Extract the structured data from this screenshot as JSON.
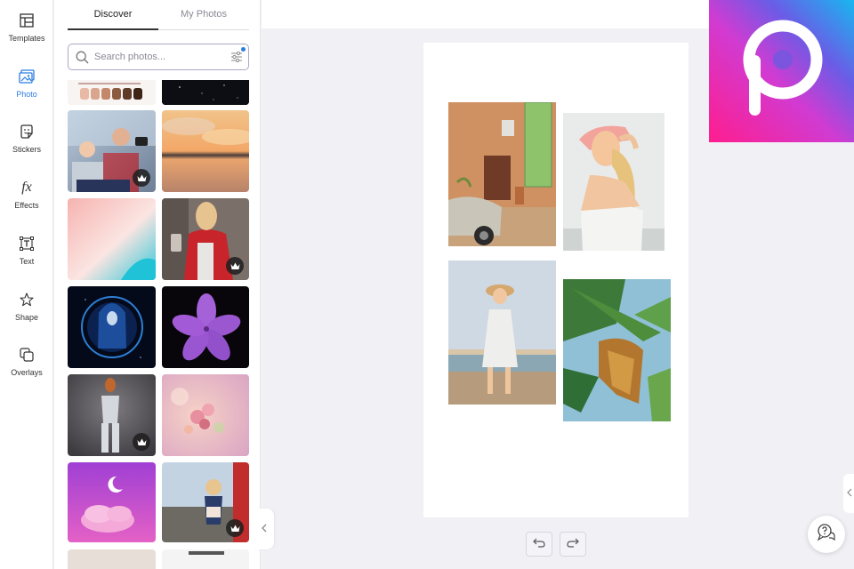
{
  "rail": {
    "items": [
      {
        "label": "Templates",
        "icon": "templates-icon"
      },
      {
        "label": "Photo",
        "icon": "photo-icon"
      },
      {
        "label": "Stickers",
        "icon": "stickers-icon"
      },
      {
        "label": "Effects",
        "icon": "effects-icon"
      },
      {
        "label": "Text",
        "icon": "text-icon"
      },
      {
        "label": "Shape",
        "icon": "shape-icon"
      },
      {
        "label": "Overlays",
        "icon": "overlays-icon"
      }
    ],
    "active": "Photo",
    "effects_glyph": "fx"
  },
  "panel": {
    "tabs": [
      {
        "label": "Discover",
        "active": true
      },
      {
        "label": "My Photos",
        "active": false
      }
    ],
    "search": {
      "placeholder": "Search photos..."
    },
    "thumbnails": [
      {
        "name": "protest-fists",
        "premium": false
      },
      {
        "name": "night-sky",
        "premium": false
      },
      {
        "name": "father-son-camera",
        "premium": true
      },
      {
        "name": "sunset-water",
        "premium": false
      },
      {
        "name": "pink-cyan-gradient",
        "premium": false
      },
      {
        "name": "woman-red-coat-coffee",
        "premium": true
      },
      {
        "name": "hooded-figure-blue",
        "premium": false
      },
      {
        "name": "purple-flower",
        "premium": false
      },
      {
        "name": "woman-white-outfit",
        "premium": true
      },
      {
        "name": "pink-blossoms",
        "premium": false
      },
      {
        "name": "pink-cloud-moon",
        "premium": false
      },
      {
        "name": "child-with-parent",
        "premium": true
      }
    ]
  },
  "canvas": {
    "photos": [
      "brick-building-car",
      "woman-pink-hat",
      "woman-beach-dress",
      "banana-leaves"
    ]
  },
  "controls": {
    "undo": "undo-icon",
    "redo": "redo-icon",
    "help": "help-chat-icon"
  },
  "colors": {
    "accent": "#2b7de0",
    "logo_pink": "#e8399a",
    "logo_blue": "#3aa0e8",
    "logo_purple": "#7b4fd4"
  }
}
